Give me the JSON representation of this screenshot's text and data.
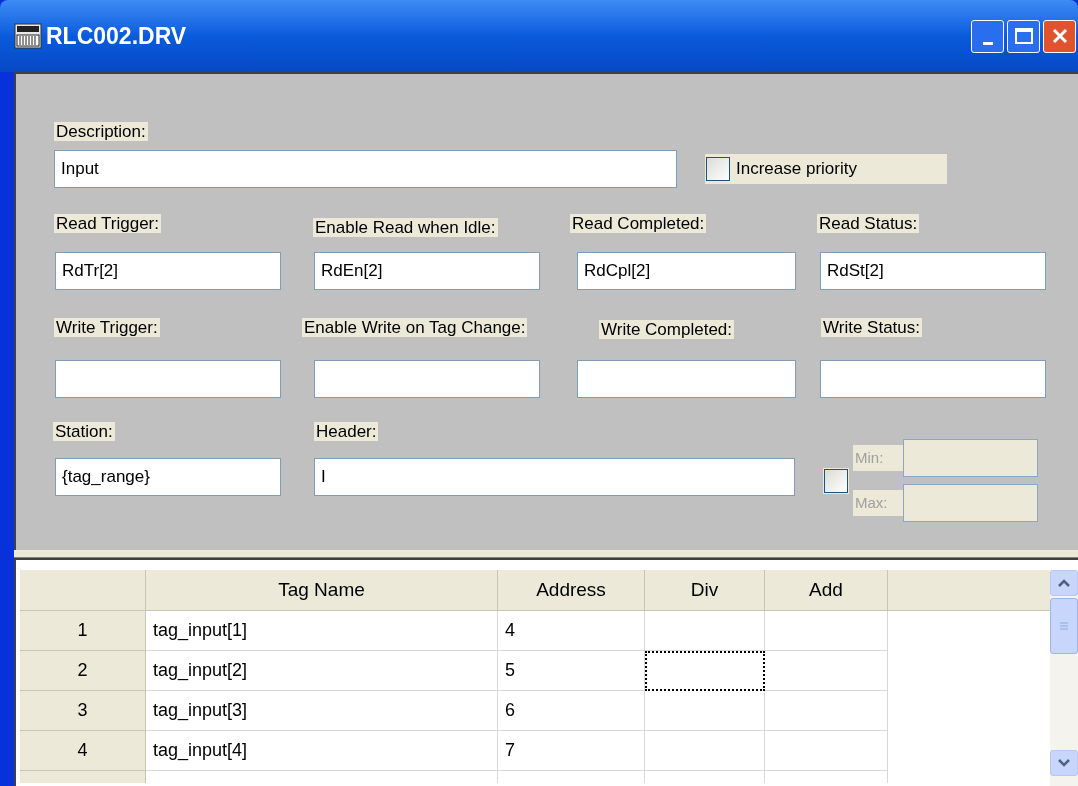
{
  "window": {
    "title": "RLC002.DRV"
  },
  "description": {
    "label": "Description:",
    "value": "Input"
  },
  "increase_priority": {
    "label": "Increase priority",
    "checked": false
  },
  "read_fields": [
    {
      "label": "Read Trigger:",
      "value": "RdTr[2]"
    },
    {
      "label": "Enable Read when Idle:",
      "value": "RdEn[2]"
    },
    {
      "label": "Read Completed:",
      "value": "RdCpl[2]"
    },
    {
      "label": "Read Status:",
      "value": "RdSt[2]"
    }
  ],
  "write_fields": [
    {
      "label": "Write Trigger:"
    },
    {
      "label": "Enable Write on Tag Change:"
    },
    {
      "label": "Write Completed:"
    },
    {
      "label": "Write Status:"
    }
  ],
  "station": {
    "label": "Station:",
    "value": "{tag_range}"
  },
  "header": {
    "label": "Header:",
    "value": "I"
  },
  "range": {
    "checked": false,
    "disabled": true,
    "min_label": "Min:",
    "max_label": "Max:"
  },
  "table": {
    "columns": [
      "Tag Name",
      "Address",
      "Div",
      "Add"
    ],
    "rows": [
      {
        "number": "1",
        "tag_name": "tag_input[1]",
        "address": "4",
        "div_focused": false
      },
      {
        "number": "2",
        "tag_name": "tag_input[2]",
        "address": "5",
        "div_focused": true
      },
      {
        "number": "3",
        "tag_name": "tag_input[3]",
        "address": "6",
        "div_focused": false
      },
      {
        "number": "4",
        "tag_name": "tag_input[4]",
        "address": "7",
        "div_focused": false
      }
    ]
  }
}
